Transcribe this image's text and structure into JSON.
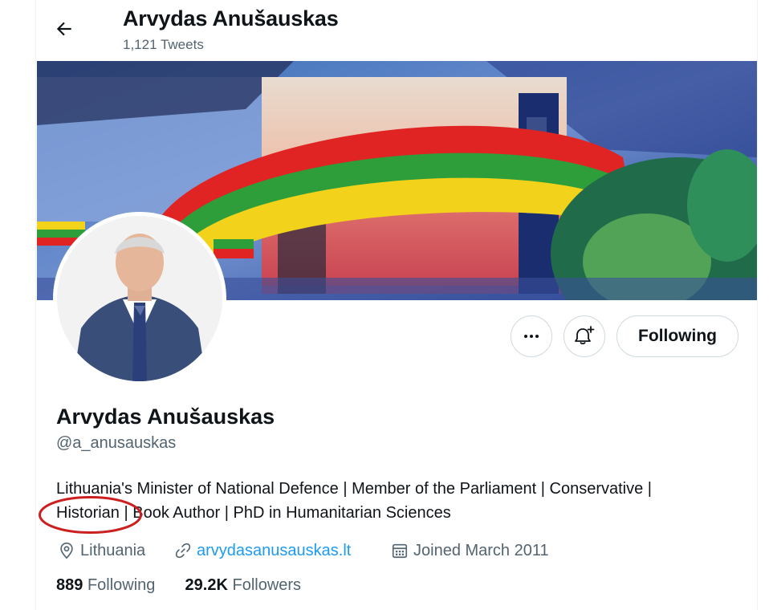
{
  "header": {
    "name": "Arvydas Anušauskas",
    "tweet_count": "1,121 Tweets"
  },
  "actions": {
    "more_icon": "ellipsis-icon",
    "notify_icon": "bell-plus-icon",
    "follow_label": "Following"
  },
  "profile": {
    "name": "Arvydas Anušauskas",
    "handle": "@a_anusauskas",
    "bio_line1": "Lithuania's Minister of National Defence | Member of the Parliament | Conservative |",
    "bio_line2_a": "Historian",
    "bio_line2_b": " | Book Author | PhD in Humanitarian Sciences",
    "location": "Lithuania",
    "website": "arvydasanusauskas.lt",
    "joined": "Joined March 2011"
  },
  "stats": {
    "following_count": "889",
    "following_label": "Following",
    "followers_count": "29.2K",
    "followers_label": "Followers"
  },
  "colors": {
    "accent": "#1d9bf0",
    "text_secondary": "#536471",
    "annotation": "#cc1f1f"
  }
}
